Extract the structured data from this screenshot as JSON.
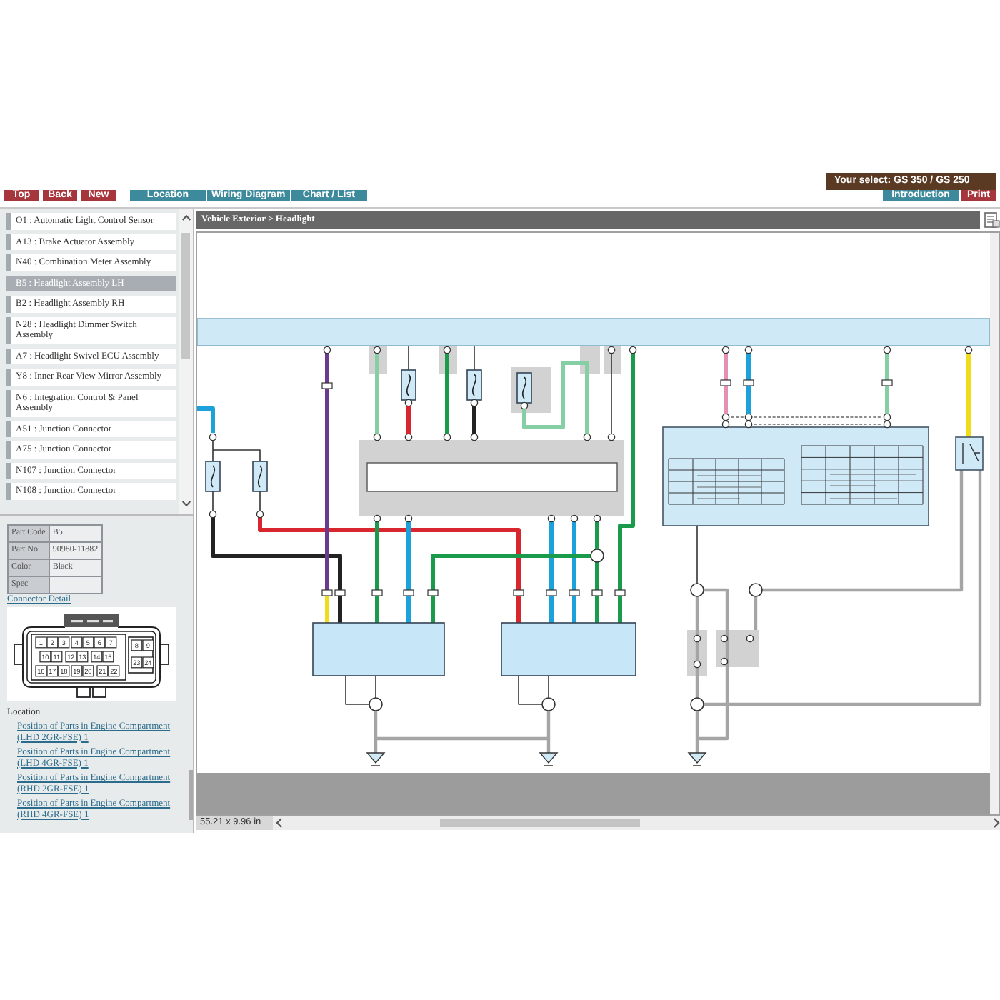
{
  "header": {
    "selection": "Your select: GS 350 / GS 250"
  },
  "toolbar": [
    {
      "label": "Top",
      "kind": "command"
    },
    {
      "label": "Back",
      "kind": "command"
    },
    {
      "label": "New",
      "kind": "command"
    },
    {
      "label": "Location",
      "kind": "view"
    },
    {
      "label": "Wiring Diagram",
      "kind": "view"
    },
    {
      "label": "Chart / List",
      "kind": "view"
    }
  ],
  "page_buttons": [
    {
      "label": "Introduction",
      "kind": "view"
    },
    {
      "label": "Print",
      "kind": "command"
    }
  ],
  "breadcrumb": "Vehicle Exterior > Headlight",
  "parts_list": [
    {
      "label": "O1 : Automatic Light Control Sensor",
      "selected": false
    },
    {
      "label": "A13 : Brake Actuator Assembly",
      "selected": false
    },
    {
      "label": "N40 : Combination Meter Assembly",
      "selected": false
    },
    {
      "label": "B5 : Headlight Assembly LH",
      "selected": true
    },
    {
      "label": "B2 : Headlight Assembly RH",
      "selected": false
    },
    {
      "label": "N28 : Headlight Dimmer Switch Assembly",
      "selected": false
    },
    {
      "label": "A7 : Headlight Swivel ECU Assembly",
      "selected": false
    },
    {
      "label": "Y8 : Inner Rear View Mirror Assembly",
      "selected": false
    },
    {
      "label": "N6 : Integration Control & Panel Assembly",
      "selected": false
    },
    {
      "label": "A51 : Junction Connector",
      "selected": false
    },
    {
      "label": "A75 : Junction Connector",
      "selected": false
    },
    {
      "label": "N107 : Junction Connector",
      "selected": false
    },
    {
      "label": "N108 : Junction Connector",
      "selected": false
    }
  ],
  "part_info": [
    {
      "label": "Part Code",
      "value": "B5"
    },
    {
      "label": "Part No.",
      "value": "90980-11882"
    },
    {
      "label": "Color",
      "value": "Black"
    },
    {
      "label": "Spec"
    }
  ],
  "connector": {
    "link": "Connector Detail",
    "main_rows": [
      [
        "1",
        "2",
        "3",
        "4",
        "5",
        "6",
        "7"
      ],
      [
        "10",
        "11",
        "12",
        "13",
        "14",
        "15"
      ],
      [
        "16",
        "17",
        "18",
        "19",
        "20",
        "21",
        "22"
      ]
    ],
    "side_rows": [
      [
        "8",
        "9"
      ],
      [
        "23",
        "24"
      ]
    ]
  },
  "location": {
    "title": "Location",
    "links": [
      "Position of Parts in Engine Compartment (LHD 2GR-FSE) 1",
      "Position of Parts in Engine Compartment (LHD 4GR-FSE) 1",
      "Position of Parts in Engine Compartment (RHD 2GR-FSE) 1",
      "Position of Parts in Engine Compartment (RHD 4GR-FSE) 1"
    ]
  },
  "status_bar": {
    "size": "55.21 x 9.96 in"
  }
}
